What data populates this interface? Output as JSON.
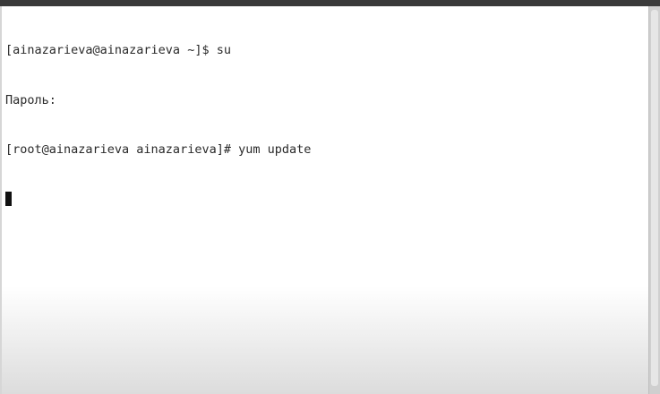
{
  "terminal": {
    "lines": [
      "[ainazarieva@ainazarieva ~]$ su",
      "Пароль:",
      "[root@ainazarieva ainazarieva]# yum update"
    ]
  },
  "colors": {
    "terminal_bg": "#ffffff",
    "terminal_text": "#2a2a2a",
    "cursor": "#111111",
    "chrome": "#d6d6d6"
  }
}
